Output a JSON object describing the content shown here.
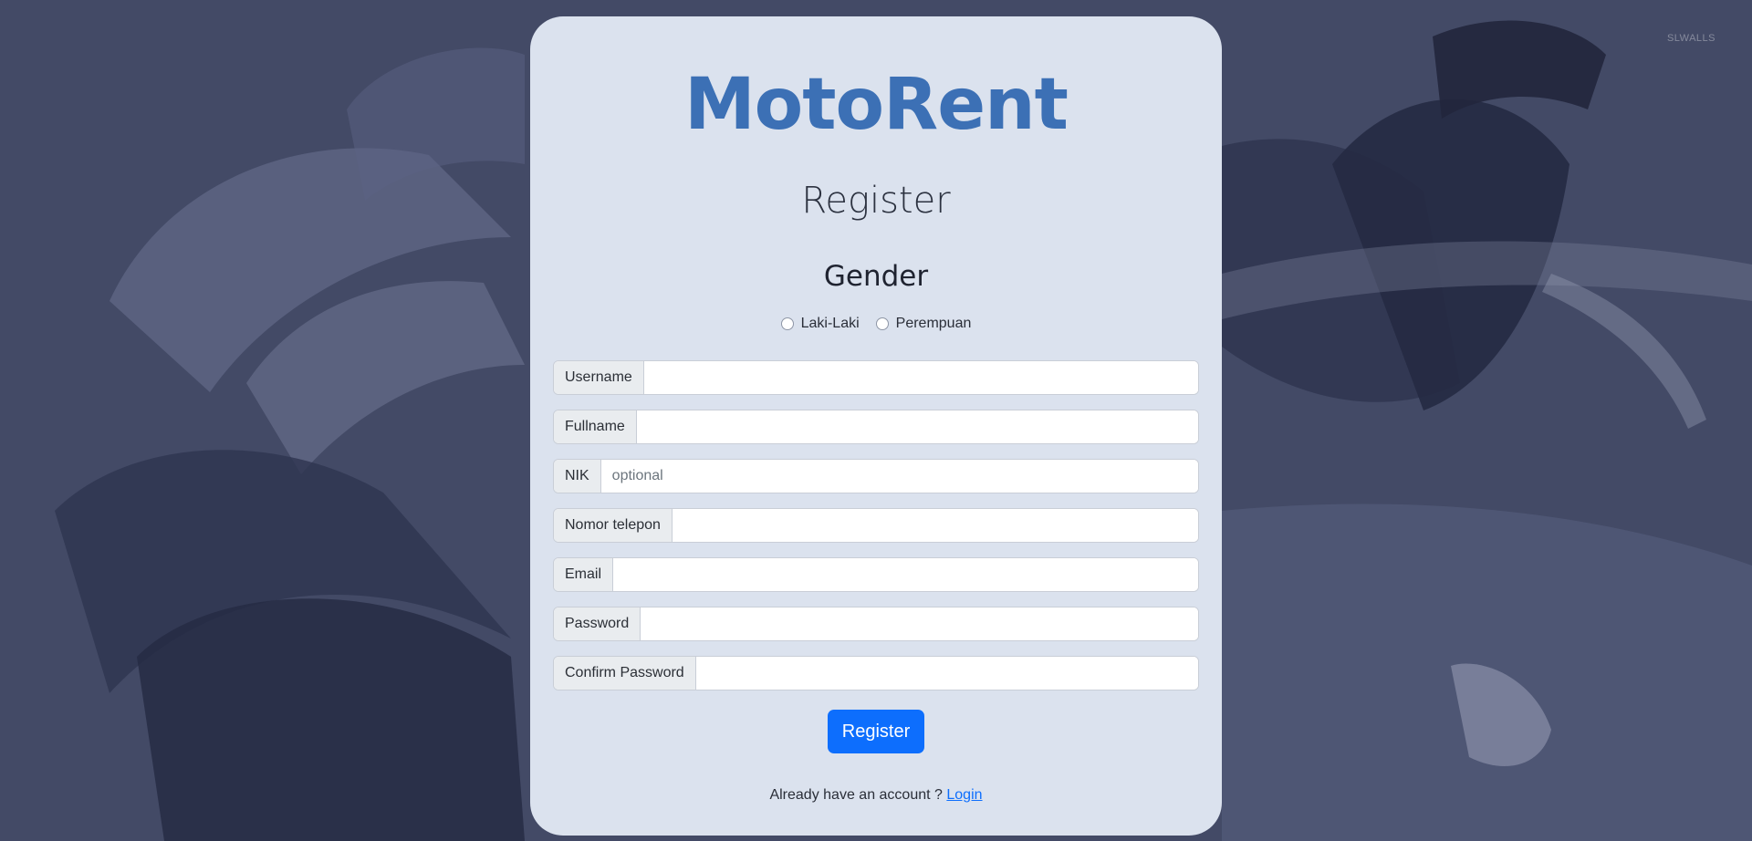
{
  "brand": {
    "logo_text": "MotoRent",
    "logo_color": "#3c70b5"
  },
  "background": {
    "watermark": "SLWALLS",
    "color": "#434a66",
    "image": "motorcycle-photo"
  },
  "form": {
    "title": "Register",
    "gender": {
      "heading": "Gender",
      "options": [
        {
          "label": "Laki-Laki",
          "checked": false
        },
        {
          "label": "Perempuan",
          "checked": false
        }
      ]
    },
    "fields": [
      {
        "label": "Username",
        "value": "",
        "placeholder": ""
      },
      {
        "label": "Fullname",
        "value": "",
        "placeholder": ""
      },
      {
        "label": "NIK",
        "value": "",
        "placeholder": "optional"
      },
      {
        "label": "Nomor telepon",
        "value": "",
        "placeholder": ""
      },
      {
        "label": "Email",
        "value": "",
        "placeholder": ""
      },
      {
        "label": "Password",
        "value": "",
        "placeholder": ""
      },
      {
        "label": "Confirm Password",
        "value": "",
        "placeholder": ""
      }
    ],
    "submit_label": "Register",
    "submit_color": "#0d6efd",
    "login_prompt": "Already have an account ?",
    "login_link": "Login"
  }
}
